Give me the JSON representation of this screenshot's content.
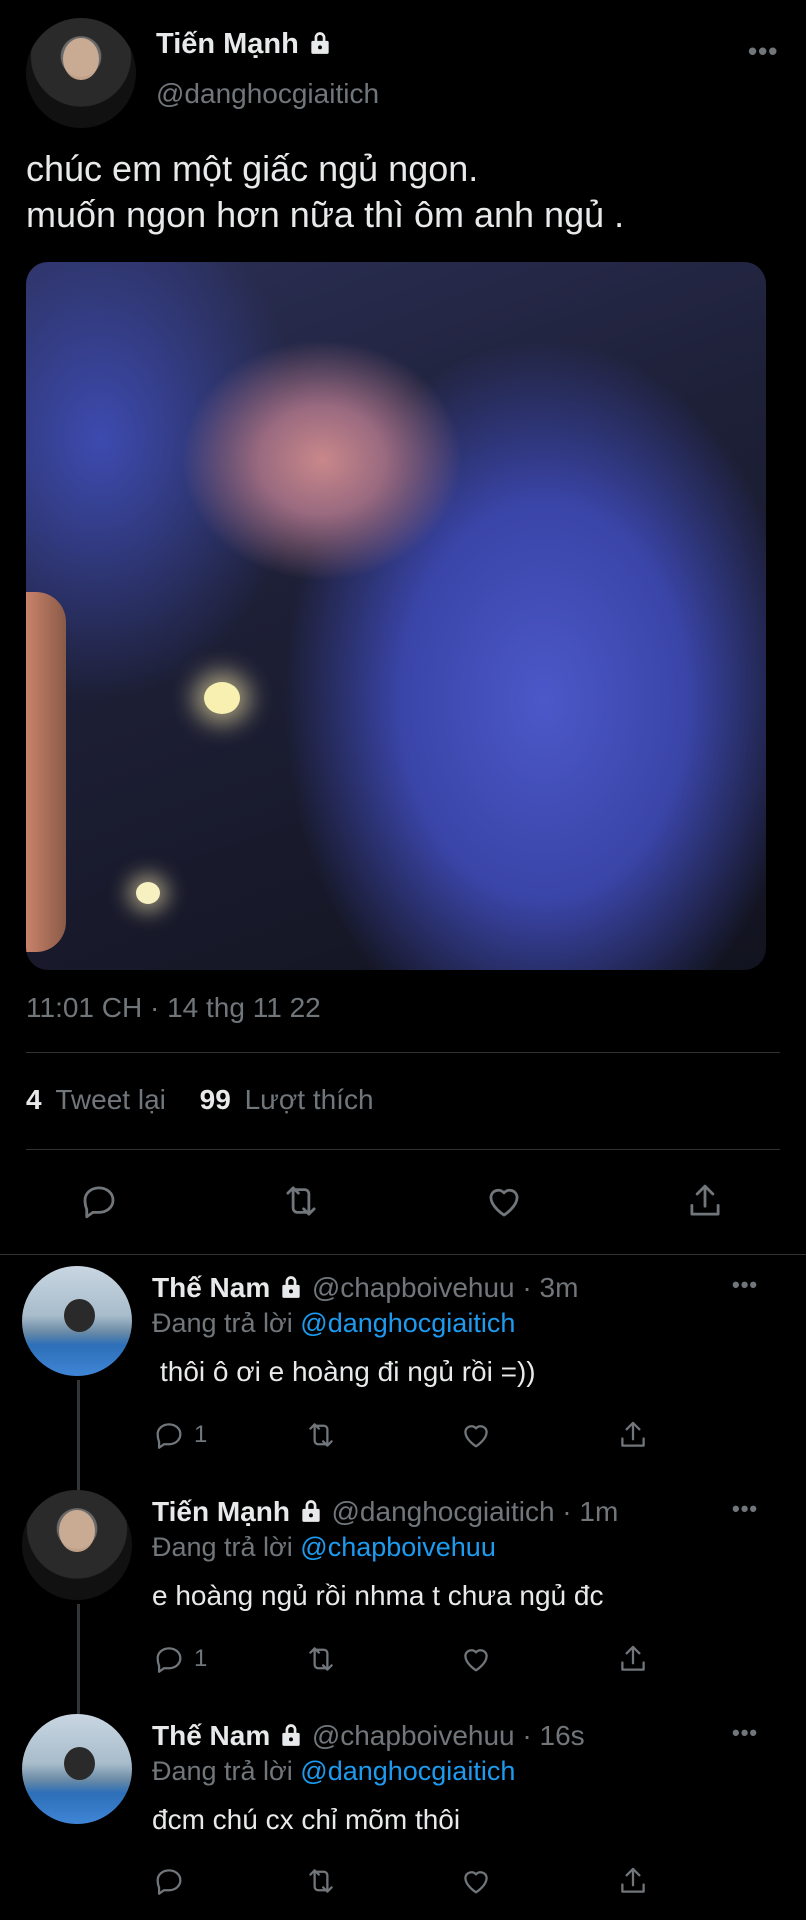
{
  "tweet": {
    "author_name": "Tiến Mạnh",
    "author_handle": "@danghocgiaitich",
    "text_line1": "chúc em một giấc ngủ ngon.",
    "text_line2": "muốn ngon hơn nữa thì ôm anh ngủ .",
    "timestamp": "11:01 CH · 14 thg 11 22",
    "retweet_count": "4",
    "retweet_label": "Tweet lại",
    "like_count": "99",
    "like_label": "Lượt thích"
  },
  "replies": [
    {
      "name": "Thế Nam",
      "handle": "@chapboivehuu",
      "time": "· 3m",
      "replying_label": "Đang trả lời",
      "replying_to": "@danghocgiaitich",
      "text": "thôi ô ơi e hoàng đi ngủ rồi =))",
      "reply_count": "1"
    },
    {
      "name": "Tiến Mạnh",
      "handle": "@danghocgiaitich",
      "time": "· 1m",
      "replying_label": "Đang trả lời",
      "replying_to": "@chapboivehuu",
      "text": "e hoàng ngủ rồi nhma t chưa ngủ đc",
      "reply_count": "1"
    },
    {
      "name": "Thế Nam",
      "handle": "@chapboivehuu",
      "time": "· 16s",
      "replying_label": "Đang trả lời",
      "replying_to": "@danghocgiaitich",
      "text": "đcm chú cx chỉ mõm thôi",
      "reply_count": ""
    }
  ],
  "icons": {
    "lock": "lock-icon",
    "more": "more-icon",
    "reply": "reply-icon",
    "retweet": "retweet-icon",
    "like": "heart-icon",
    "share": "share-icon"
  },
  "colors": {
    "background": "#000000",
    "text": "#e7e9ea",
    "secondary": "#71767b",
    "link": "#1d9bf0",
    "divider": "#2f3336"
  }
}
